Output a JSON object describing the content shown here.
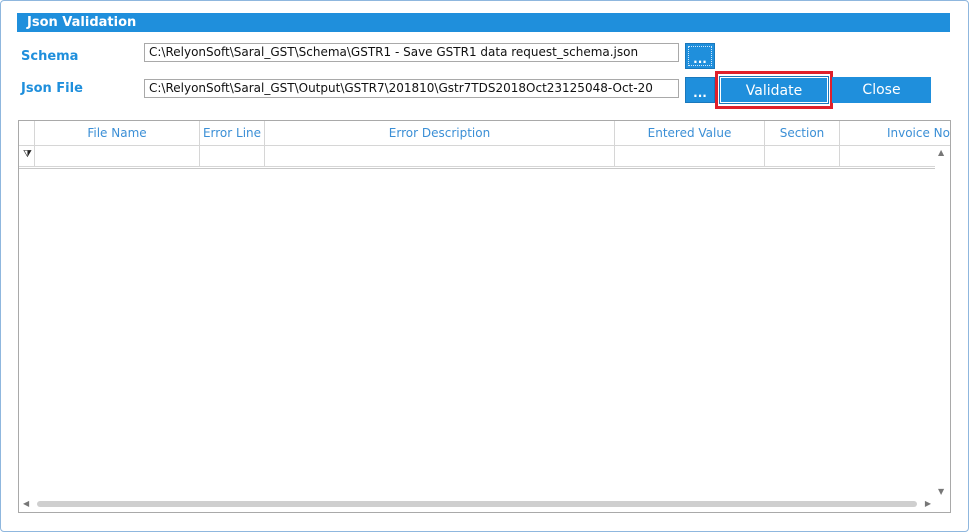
{
  "window": {
    "title": "Json Validation"
  },
  "schema": {
    "label": "Schema",
    "path": "C:\\RelyonSoft\\Saral_GST\\Schema\\GSTR1 - Save GSTR1 data request_schema.json",
    "browse_label": "..."
  },
  "json_file": {
    "label": "Json File",
    "path": "C:\\RelyonSoft\\Saral_GST\\Output\\GSTR7\\201810\\Gstr7TDS2018Oct23125048-Oct-20",
    "browse_label": "..."
  },
  "buttons": {
    "validate": "Validate",
    "close": "Close"
  },
  "grid": {
    "columns": [
      "File Name",
      "Error Line",
      "Error Description",
      "Entered Value",
      "Section",
      "Invoice No"
    ],
    "filter_icon": "filter-icon"
  },
  "colors": {
    "accent": "#1f8fdc",
    "highlight": "#e0202b"
  }
}
